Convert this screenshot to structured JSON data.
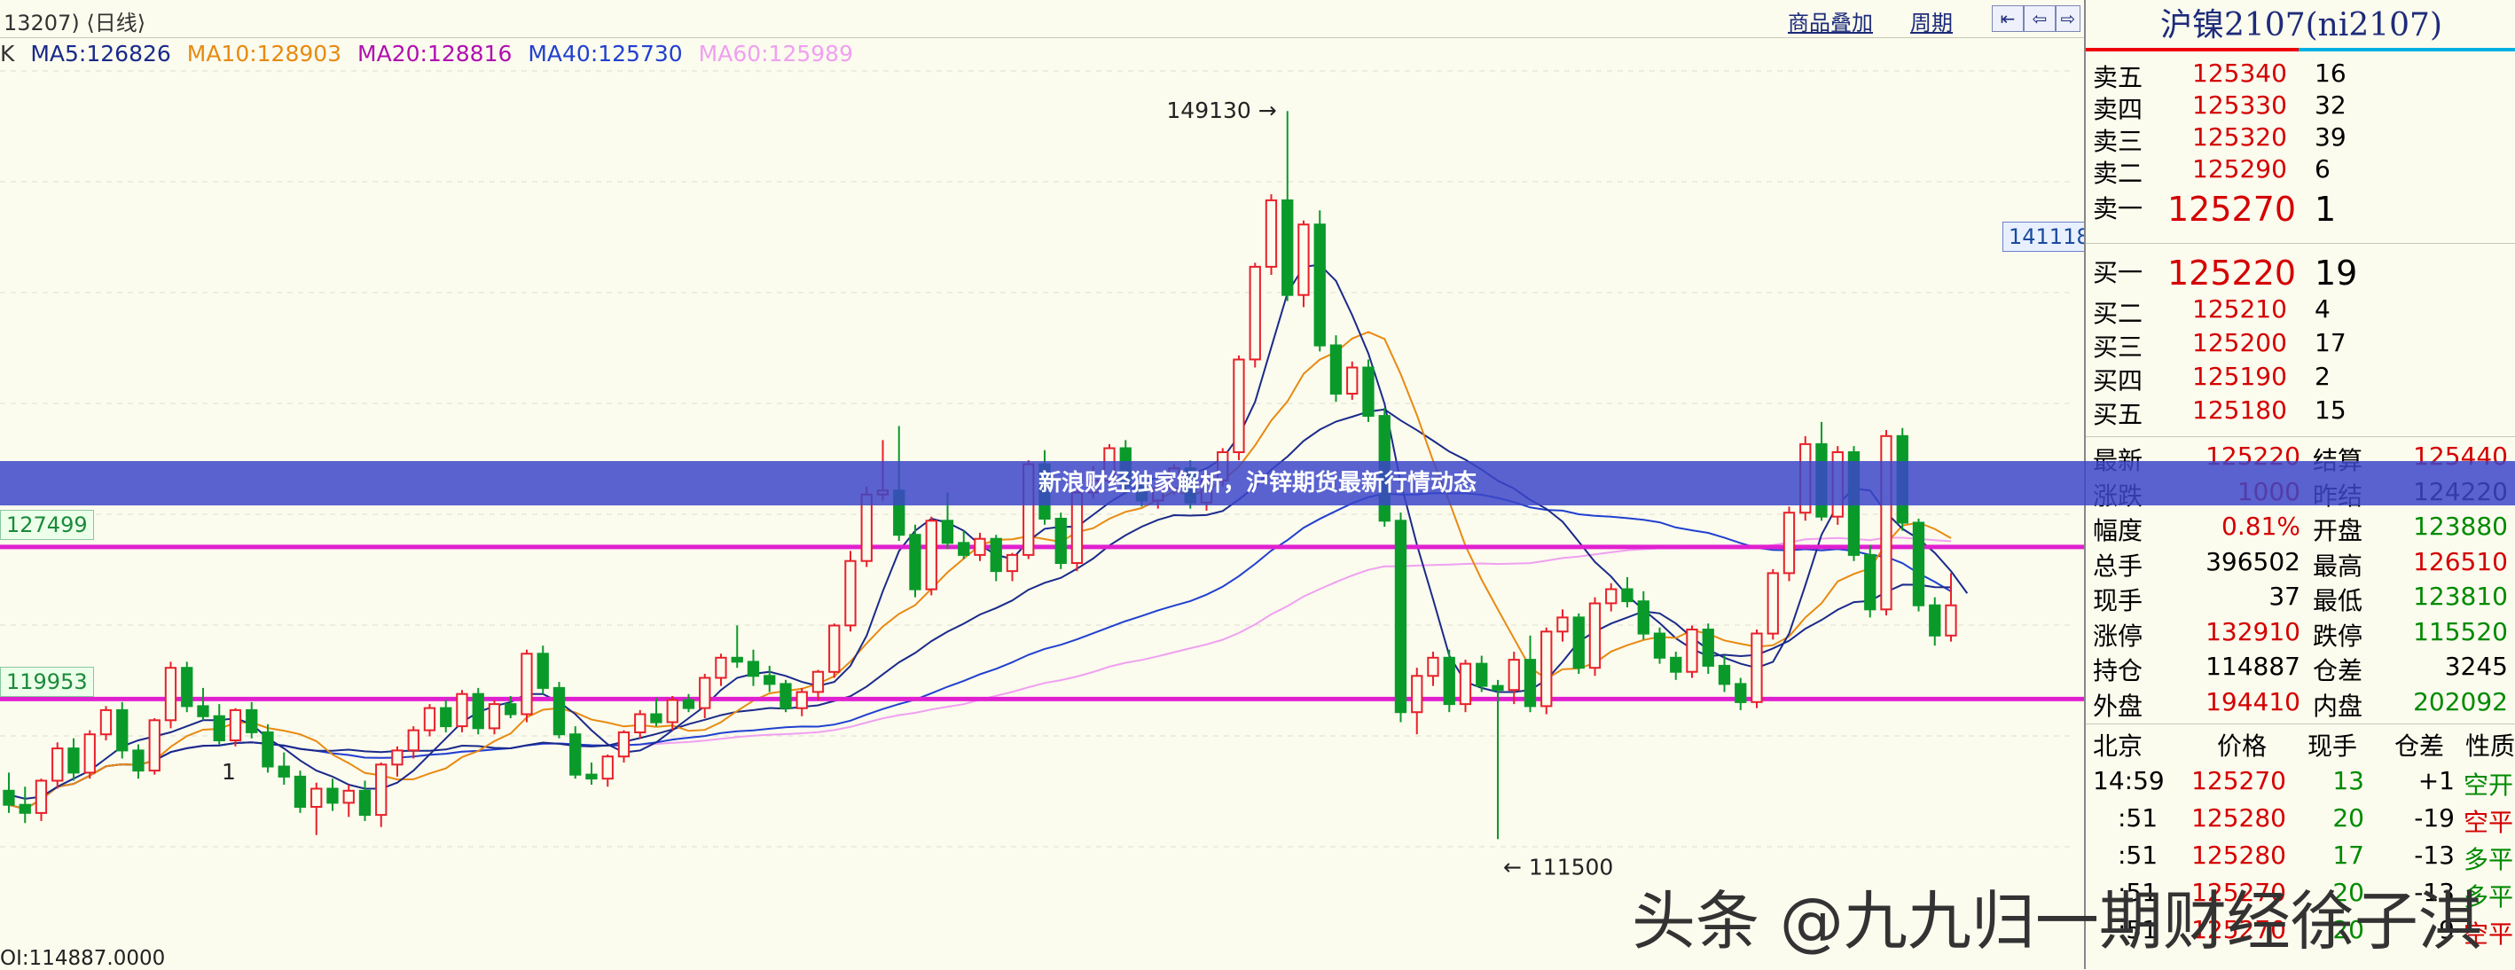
{
  "toolbar": {
    "left_text": "13207)  ⟨日线⟩",
    "overlay_label": "商品叠加",
    "period_label": "周期"
  },
  "ma_legend": {
    "prefix": "K",
    "ma5": "MA5:126826",
    "ma10": "MA10:128903",
    "ma20": "MA20:128816",
    "ma40": "MA40:125730",
    "ma60": "MA60:125989"
  },
  "colors": {
    "up": "#e8202a",
    "down": "#0a9a2a",
    "ma5": "#1a2a8a",
    "ma10": "#e88a10",
    "ma20": "#d020d0",
    "ma40": "#2040d0",
    "ma60": "#f0a0f0",
    "hline": "#e020d0"
  },
  "chart_data": {
    "type": "candlestick",
    "y_range": [
      108000,
      152000
    ],
    "annotations": {
      "high_label": "149130",
      "low_label": "111500",
      "right_price_label": "141118",
      "level_upper_label": "127499",
      "level_lower_label": "119953",
      "small_label": "1"
    },
    "levels": [
      127499,
      119953
    ],
    "candles": [
      [
        115400,
        116300,
        114300,
        114700
      ],
      [
        114700,
        115600,
        113800,
        114300
      ],
      [
        114300,
        116000,
        113900,
        115900
      ],
      [
        115900,
        117800,
        115500,
        117500
      ],
      [
        117500,
        118000,
        115900,
        116300
      ],
      [
        116300,
        118400,
        116000,
        118200
      ],
      [
        118200,
        119600,
        117900,
        119400
      ],
      [
        119400,
        119800,
        117000,
        117400
      ],
      [
        117400,
        117700,
        116000,
        116400
      ],
      [
        116400,
        119000,
        116200,
        118900
      ],
      [
        118900,
        121800,
        118500,
        121500
      ],
      [
        121500,
        121800,
        119300,
        119600
      ],
      [
        119600,
        120500,
        118900,
        119100
      ],
      [
        119100,
        119700,
        117700,
        117900
      ],
      [
        117900,
        119500,
        117600,
        119400
      ],
      [
        119400,
        119800,
        118000,
        118300
      ],
      [
        118300,
        118700,
        116300,
        116600
      ],
      [
        116600,
        117300,
        115700,
        116100
      ],
      [
        116100,
        116400,
        114300,
        114600
      ],
      [
        114600,
        115800,
        113200,
        115500
      ],
      [
        115500,
        116000,
        114400,
        114800
      ],
      [
        114800,
        115700,
        114100,
        115400
      ],
      [
        115400,
        115900,
        113900,
        114200
      ],
      [
        114200,
        116800,
        113600,
        116700
      ],
      [
        116700,
        117600,
        116100,
        117400
      ],
      [
        117400,
        118600,
        117000,
        118400
      ],
      [
        118400,
        119700,
        118100,
        119500
      ],
      [
        119500,
        119900,
        118300,
        118600
      ],
      [
        118600,
        120400,
        118300,
        120200
      ],
      [
        120200,
        120500,
        118200,
        118500
      ],
      [
        118500,
        119900,
        118200,
        119700
      ],
      [
        119700,
        120100,
        119000,
        119200
      ],
      [
        119200,
        122400,
        118800,
        122200
      ],
      [
        122200,
        122600,
        120200,
        120500
      ],
      [
        120500,
        120800,
        118000,
        118200
      ],
      [
        118200,
        118600,
        116000,
        116200
      ],
      [
        116200,
        116800,
        115700,
        116000
      ],
      [
        116000,
        117200,
        115600,
        117100
      ],
      [
        117100,
        118400,
        116800,
        118300
      ],
      [
        118300,
        119400,
        118000,
        119200
      ],
      [
        119200,
        120000,
        118600,
        118800
      ],
      [
        118800,
        120100,
        118400,
        119900
      ],
      [
        119900,
        120200,
        119300,
        119500
      ],
      [
        119500,
        121200,
        119000,
        121000
      ],
      [
        121000,
        122200,
        120600,
        122000
      ],
      [
        122000,
        123600,
        121500,
        121800
      ],
      [
        121800,
        122400,
        120600,
        121100
      ],
      [
        121100,
        121600,
        120300,
        120700
      ],
      [
        120700,
        120900,
        119300,
        119500
      ],
      [
        119500,
        120500,
        119100,
        120300
      ],
      [
        120300,
        121400,
        119900,
        121300
      ],
      [
        121300,
        123700,
        121000,
        123600
      ],
      [
        123600,
        127300,
        123300,
        126800
      ],
      [
        126800,
        130500,
        126500,
        130100
      ],
      [
        130100,
        132800,
        129800,
        130300
      ],
      [
        130300,
        133500,
        127800,
        128100
      ],
      [
        128100,
        128600,
        125000,
        125400
      ],
      [
        125400,
        129000,
        125100,
        128800
      ],
      [
        128800,
        130200,
        127400,
        127700
      ],
      [
        127700,
        128300,
        126900,
        127100
      ],
      [
        127100,
        128200,
        126800,
        127900
      ],
      [
        127900,
        128100,
        125800,
        126300
      ],
      [
        126300,
        127200,
        125800,
        127100
      ],
      [
        127100,
        131800,
        126900,
        131600
      ],
      [
        131600,
        132300,
        128600,
        128900
      ],
      [
        128900,
        129200,
        126400,
        126700
      ],
      [
        126700,
        130400,
        126300,
        130200
      ],
      [
        130200,
        131500,
        129900,
        130800
      ],
      [
        130800,
        132600,
        130500,
        132400
      ],
      [
        132400,
        132800,
        130100,
        130500
      ],
      [
        130500,
        131100,
        129500,
        129800
      ],
      [
        129800,
        130700,
        129400,
        130400
      ],
      [
        130400,
        131600,
        130100,
        131400
      ],
      [
        131400,
        131800,
        129400,
        129700
      ],
      [
        129700,
        131000,
        129300,
        130800
      ],
      [
        130800,
        132400,
        130500,
        132200
      ],
      [
        132200,
        137000,
        131800,
        136800
      ],
      [
        136800,
        141600,
        136400,
        141400
      ],
      [
        141400,
        145000,
        141000,
        144700
      ],
      [
        144700,
        149130,
        139700,
        140000
      ],
      [
        140000,
        143700,
        139400,
        143500
      ],
      [
        143500,
        144200,
        137200,
        137500
      ],
      [
        137500,
        138000,
        134700,
        135100
      ],
      [
        135100,
        136700,
        134800,
        136400
      ],
      [
        136400,
        136800,
        133700,
        134000
      ],
      [
        134000,
        134400,
        128500,
        128800
      ],
      [
        128800,
        129200,
        118800,
        119300
      ],
      [
        119300,
        121500,
        118200,
        121100
      ],
      [
        121100,
        122300,
        120600,
        122000
      ],
      [
        122000,
        122400,
        119300,
        119700
      ],
      [
        119700,
        121900,
        119300,
        121700
      ],
      [
        121700,
        122100,
        120300,
        120600
      ],
      [
        120600,
        120900,
        113000,
        120400
      ],
      [
        120400,
        122300,
        119700,
        121900
      ],
      [
        121900,
        123100,
        119300,
        119600
      ],
      [
        119600,
        123500,
        119200,
        123300
      ],
      [
        123300,
        124400,
        122800,
        124000
      ],
      [
        124000,
        124200,
        121200,
        121500
      ],
      [
        121500,
        125000,
        121100,
        124700
      ],
      [
        124700,
        125700,
        124300,
        125400
      ],
      [
        125400,
        126000,
        124500,
        124800
      ],
      [
        124800,
        125300,
        122900,
        123200
      ],
      [
        123200,
        123500,
        121700,
        122000
      ],
      [
        122000,
        122300,
        120900,
        121300
      ],
      [
        121300,
        123600,
        121000,
        123400
      ],
      [
        123400,
        123700,
        121200,
        121600
      ],
      [
        121600,
        122100,
        120300,
        120700
      ],
      [
        120700,
        121000,
        119400,
        119800
      ],
      [
        119800,
        123400,
        119500,
        123200
      ],
      [
        123200,
        126400,
        122900,
        126200
      ],
      [
        126200,
        129500,
        125800,
        129200
      ],
      [
        129200,
        133000,
        128800,
        132600
      ],
      [
        132600,
        133700,
        128800,
        129000
      ],
      [
        129000,
        132500,
        128600,
        132200
      ],
      [
        132200,
        132500,
        126800,
        127100
      ],
      [
        127100,
        127600,
        124000,
        124400
      ],
      [
        124400,
        133300,
        124100,
        133000
      ],
      [
        133000,
        133400,
        128300,
        128700
      ],
      [
        128700,
        128900,
        124300,
        124600
      ],
      [
        124600,
        125000,
        122600,
        123100
      ],
      [
        123100,
        126200,
        122800,
        124600
      ]
    ],
    "ma5": [
      115200,
      115000,
      115100,
      115600,
      116000,
      116400,
      117000,
      117600,
      117900,
      118100,
      118300,
      118600,
      118900,
      118900,
      119000,
      118700,
      118000,
      117500,
      116900,
      116400,
      116100,
      115700,
      115500,
      115500,
      115800,
      116400,
      117200,
      118000,
      118800,
      119300,
      119600,
      119800,
      120200,
      120200,
      119800,
      119200,
      118400,
      117700,
      117300,
      117400,
      117800,
      118400,
      119000,
      119600,
      120400,
      121000,
      121200,
      121300,
      121100,
      120800,
      120600,
      120800,
      121600,
      123100,
      125300,
      127300,
      128300,
      128900,
      128700,
      128300,
      127600,
      127100,
      126900,
      127800,
      128400,
      128500,
      128500,
      129100,
      129700,
      130200,
      130600,
      131000,
      131100,
      131100,
      131400,
      131900,
      133000,
      134700,
      137400,
      140100,
      141400,
      141500,
      140700,
      139000,
      137100,
      134600,
      130700,
      127600,
      124900,
      122100,
      120800,
      120500,
      120300,
      120300,
      120400,
      120900,
      121800,
      122800,
      123300,
      123700,
      124000,
      124300,
      124200,
      123700,
      123000,
      122400,
      122000,
      121700,
      121500,
      121800,
      123200,
      125600,
      128100,
      129600,
      130400,
      130300,
      129200,
      128400,
      127900,
      127200,
      126300,
      125200
    ]
  },
  "panel": {
    "title": "沪镍2107(ni2107)",
    "asks": [
      {
        "label": "卖五",
        "price": "125340",
        "vol": "16"
      },
      {
        "label": "卖四",
        "price": "125330",
        "vol": "32"
      },
      {
        "label": "卖三",
        "price": "125320",
        "vol": "39"
      },
      {
        "label": "卖二",
        "price": "125290",
        "vol": "6"
      },
      {
        "label": "卖一",
        "price": "125270",
        "vol": "1"
      }
    ],
    "bids": [
      {
        "label": "买一",
        "price": "125220",
        "vol": "19"
      },
      {
        "label": "买二",
        "price": "125210",
        "vol": "4"
      },
      {
        "label": "买三",
        "price": "125200",
        "vol": "17"
      },
      {
        "label": "买四",
        "price": "125190",
        "vol": "2"
      },
      {
        "label": "买五",
        "price": "125180",
        "vol": "15"
      }
    ],
    "stats": [
      {
        "k1": "最新",
        "v1": "125220",
        "k2": "结算",
        "v2": "125440",
        "c1": "red",
        "c2": "red"
      },
      {
        "k1": "涨跌",
        "v1": "1000",
        "k2": "昨结",
        "v2": "124220",
        "c1": "red",
        "c2": "black"
      },
      {
        "k1": "幅度",
        "v1": "0.81%",
        "k2": "开盘",
        "v2": "123880",
        "c1": "red",
        "c2": "green"
      },
      {
        "k1": "总手",
        "v1": "396502",
        "k2": "最高",
        "v2": "126510",
        "c1": "black",
        "c2": "red"
      },
      {
        "k1": "现手",
        "v1": "37",
        "k2": "最低",
        "v2": "123810",
        "c1": "black",
        "c2": "green"
      },
      {
        "k1": "涨停",
        "v1": "132910",
        "k2": "跌停",
        "v2": "115520",
        "c1": "red",
        "c2": "green"
      },
      {
        "k1": "持仓",
        "v1": "114887",
        "k2": "仓差",
        "v2": "3245",
        "c1": "black",
        "c2": "black"
      },
      {
        "k1": "外盘",
        "v1": "194410",
        "k2": "内盘",
        "v2": "202092",
        "c1": "red",
        "c2": "green"
      }
    ],
    "ticks_header": {
      "place": "北京",
      "price": "价格",
      "vol": "现手",
      "oi": "仓差",
      "nature": "性质"
    },
    "ticks": [
      {
        "time": "14:59",
        "price": "125270",
        "vol": "13",
        "oi": "+1",
        "nature": "空开",
        "nc": "green"
      },
      {
        "time": ":51",
        "price": "125280",
        "vol": "20",
        "oi": "-19",
        "nature": "空平",
        "nc": "red"
      },
      {
        "time": ":51",
        "price": "125280",
        "vol": "17",
        "oi": "-13",
        "nature": "多平",
        "nc": "green"
      },
      {
        "time": ":51",
        "price": "125270",
        "vol": "20",
        "oi": "-13",
        "nature": "多平",
        "nc": "green"
      },
      {
        "time": ":51",
        "price": "125270",
        "vol": "20",
        "oi": "9",
        "nature": "空平",
        "nc": "red"
      }
    ]
  },
  "banner_text": "新浪财经独家解析，沪锌期货最新行情动态",
  "oi_text": "OI:114887.0000",
  "watermark": "头条 @九九归一期财经徐子淇"
}
